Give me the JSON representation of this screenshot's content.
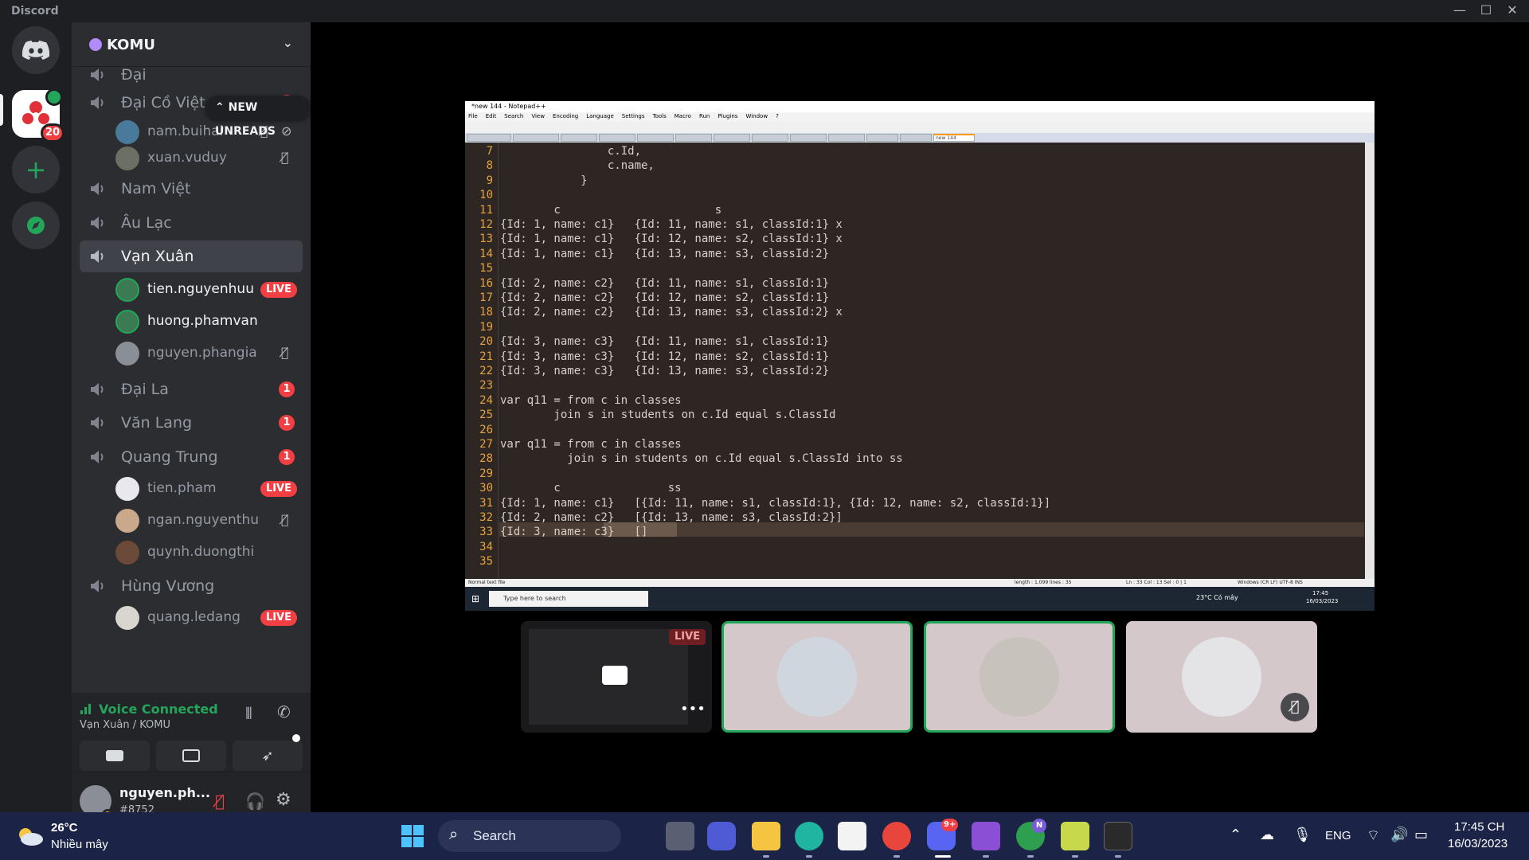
{
  "app": {
    "name": "Discord"
  },
  "server": {
    "name": "KOMU",
    "mention_count": "20"
  },
  "new_unreads": "NEW UNREADS",
  "channels": [
    {
      "name": "Đại",
      "badge": ""
    },
    {
      "name": "Đại Cồ Việt (task)",
      "badge": "1",
      "users": [
        {
          "name": "nam.buihai"
        },
        {
          "name": "xuan.vuduy"
        }
      ]
    },
    {
      "name": "Nam Việt",
      "badge": ""
    },
    {
      "name": "Âu Lạc",
      "badge": ""
    },
    {
      "name": "Vạn Xuân",
      "badge": "",
      "active": true,
      "users": [
        {
          "name": "tien.nguyenhuu",
          "live": "LIVE"
        },
        {
          "name": "huong.phamvan"
        },
        {
          "name": "nguyen.phangia"
        }
      ]
    },
    {
      "name": "Đại La",
      "badge": "1"
    },
    {
      "name": "Văn Lang",
      "badge": "1"
    },
    {
      "name": "Quang Trung",
      "badge": "1",
      "users": [
        {
          "name": "tien.pham",
          "live": "LIVE"
        },
        {
          "name": "ngan.nguyenthu"
        },
        {
          "name": "quynh.duongthi"
        }
      ]
    },
    {
      "name": "Hùng Vương",
      "badge": "",
      "users": [
        {
          "name": "quang.ledang",
          "live": "LIVE"
        }
      ]
    }
  ],
  "voice": {
    "status": "Voice Connected",
    "location": "Vạn Xuân / KOMU"
  },
  "current_user": {
    "name": "nguyen.ph...",
    "tag": "#8752"
  },
  "stream": {
    "window_title": "*new 144 - Notepad++",
    "menu": [
      "File",
      "Edit",
      "Search",
      "View",
      "Encoding",
      "Language",
      "Settings",
      "Tools",
      "Macro",
      "Run",
      "Plugins",
      "Window",
      "?"
    ],
    "active_tab": "new 144",
    "status_left": "Normal text file",
    "status_mid": "length : 1,099    lines : 35",
    "status_pos": "Ln : 33    Col : 13    Sel : 0 | 1",
    "status_right": "Windows (CR LF)    UTF-8    INS",
    "taskbar_search": "Type here to search",
    "weather": "23°C  Có mây",
    "time": "17:45",
    "date": "16/03/2023",
    "lines": [
      {
        "n": "7",
        "t": "                c.Id,"
      },
      {
        "n": "8",
        "t": "                c.name,"
      },
      {
        "n": "9",
        "t": "            }"
      },
      {
        "n": "10",
        "t": ""
      },
      {
        "n": "11",
        "t": "        c                       s"
      },
      {
        "n": "12",
        "t": "{Id: 1, name: c1}   {Id: 11, name: s1, classId:1} x"
      },
      {
        "n": "13",
        "t": "{Id: 1, name: c1}   {Id: 12, name: s2, classId:1} x"
      },
      {
        "n": "14",
        "t": "{Id: 1, name: c1}   {Id: 13, name: s3, classId:2}"
      },
      {
        "n": "15",
        "t": ""
      },
      {
        "n": "16",
        "t": "{Id: 2, name: c2}   {Id: 11, name: s1, classId:1}"
      },
      {
        "n": "17",
        "t": "{Id: 2, name: c2}   {Id: 12, name: s2, classId:1}"
      },
      {
        "n": "18",
        "t": "{Id: 2, name: c2}   {Id: 13, name: s3, classId:2} x"
      },
      {
        "n": "19",
        "t": ""
      },
      {
        "n": "20",
        "t": "{Id: 3, name: c3}   {Id: 11, name: s1, classId:1}"
      },
      {
        "n": "21",
        "t": "{Id: 3, name: c3}   {Id: 12, name: s2, classId:1}"
      },
      {
        "n": "22",
        "t": "{Id: 3, name: c3}   {Id: 13, name: s3, classId:2}"
      },
      {
        "n": "23",
        "t": ""
      },
      {
        "n": "24",
        "t": "var q11 = from c in classes"
      },
      {
        "n": "25",
        "t": "        join s in students on c.Id equal s.ClassId"
      },
      {
        "n": "26",
        "t": ""
      },
      {
        "n": "27",
        "t": "var q11 = from c in classes"
      },
      {
        "n": "28",
        "t": "          join s in students on c.Id equal s.ClassId into ss"
      },
      {
        "n": "29",
        "t": ""
      },
      {
        "n": "30",
        "t": "        c                ss"
      },
      {
        "n": "31",
        "t": "{Id: 1, name: c1}   [{Id: 11, name: s1, classId:1}, {Id: 12, name: s2, classId:1}]"
      },
      {
        "n": "32",
        "t": "{Id: 2, name: c2}   [{Id: 13, name: s3, classId:2}]"
      },
      {
        "n": "33",
        "t": "{Id: 3, name: c3}   []"
      },
      {
        "n": "34",
        "t": ""
      },
      {
        "n": "35",
        "t": ""
      }
    ]
  },
  "tiles": [
    {
      "live": "LIVE"
    }
  ],
  "taskbar": {
    "temp": "26°C",
    "weather": "Nhiều mây",
    "search": "Search",
    "discord_badge": "9+",
    "chrome_badge": "N",
    "lang": "ENG",
    "time": "17:45 CH",
    "date": "16/03/2023"
  },
  "colors": {
    "accent": "#23a55a",
    "live": "#f23f43",
    "blurple": "#5865f2"
  }
}
